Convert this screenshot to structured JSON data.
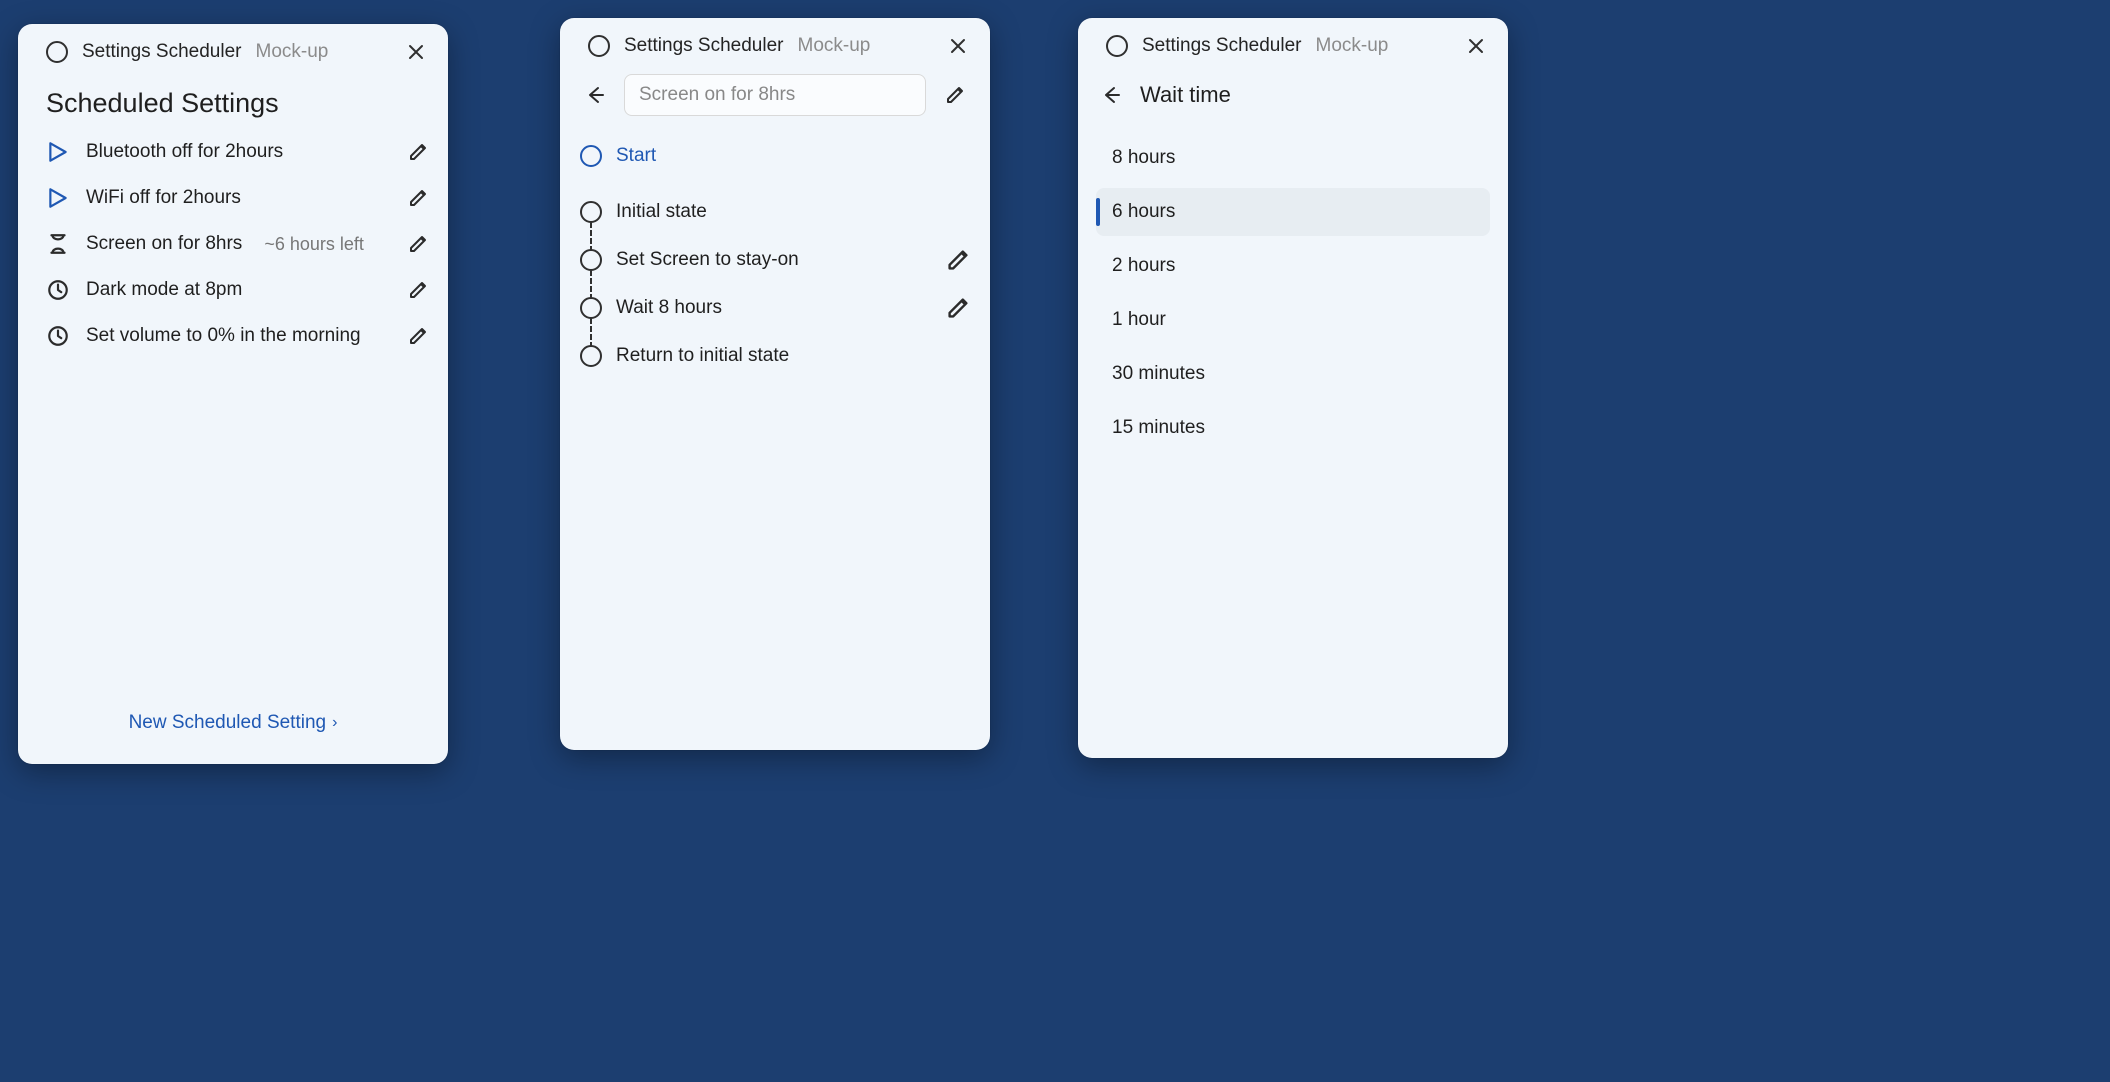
{
  "app": {
    "title": "Settings Scheduler",
    "subtitle": "Mock-up"
  },
  "colors": {
    "accent": "#1f58b3",
    "panel_bg": "#f1f6fb",
    "page_bg": "#1c3e70"
  },
  "panel_a": {
    "heading": "Scheduled Settings",
    "items": [
      {
        "icon": "play",
        "label": "Bluetooth off for 2hours",
        "hint": ""
      },
      {
        "icon": "play",
        "label": "WiFi off for 2hours",
        "hint": ""
      },
      {
        "icon": "hourglass",
        "label": "Screen on for 8hrs",
        "hint": "~6 hours left"
      },
      {
        "icon": "clock",
        "label": "Dark mode at  8pm",
        "hint": ""
      },
      {
        "icon": "clock",
        "label": "Set volume to 0% in the morning",
        "hint": ""
      }
    ],
    "footer": "New Scheduled Setting"
  },
  "panel_b": {
    "name_field": "Screen on for 8hrs",
    "start_label": "Start",
    "steps": [
      {
        "label": "Initial state",
        "editable": false
      },
      {
        "label": "Set Screen to stay-on",
        "editable": true
      },
      {
        "label": "Wait 8 hours",
        "editable": true
      },
      {
        "label": "Return to initial state",
        "editable": false
      }
    ]
  },
  "panel_c": {
    "heading": "Wait time",
    "options": [
      {
        "label": "8 hours",
        "selected": false
      },
      {
        "label": "6 hours",
        "selected": true
      },
      {
        "label": "2 hours",
        "selected": false
      },
      {
        "label": "1 hour",
        "selected": false
      },
      {
        "label": "30 minutes",
        "selected": false
      },
      {
        "label": "15 minutes",
        "selected": false
      }
    ]
  }
}
